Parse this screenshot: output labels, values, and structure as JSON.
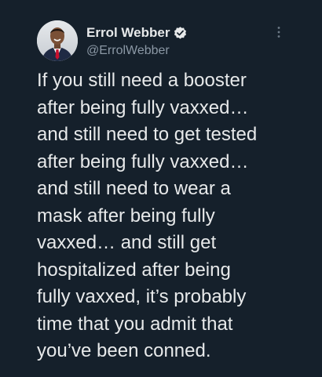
{
  "author": {
    "display_name": "Errol Webber",
    "handle": "@ErrolWebber",
    "avatar_icon": "profile-photo",
    "verified_icon": "verified-badge-icon"
  },
  "tweet": {
    "lines": [
      "If you still need a booster",
      "after being fully vaxxed…",
      "and still need to get tested",
      "after being fully vaxxed…",
      "and still need to wear a",
      "mask after being fully",
      "vaxxed… and still get",
      "hospitalized after being",
      "fully vaxxed, it’s probably",
      "time that you admit that",
      "you’ve been conned."
    ]
  },
  "more_menu_icon": "more-vertical-icon",
  "colors": {
    "background": "#15202b",
    "text_primary": "#e7e9ea",
    "text_secondary": "#8b98a5"
  }
}
